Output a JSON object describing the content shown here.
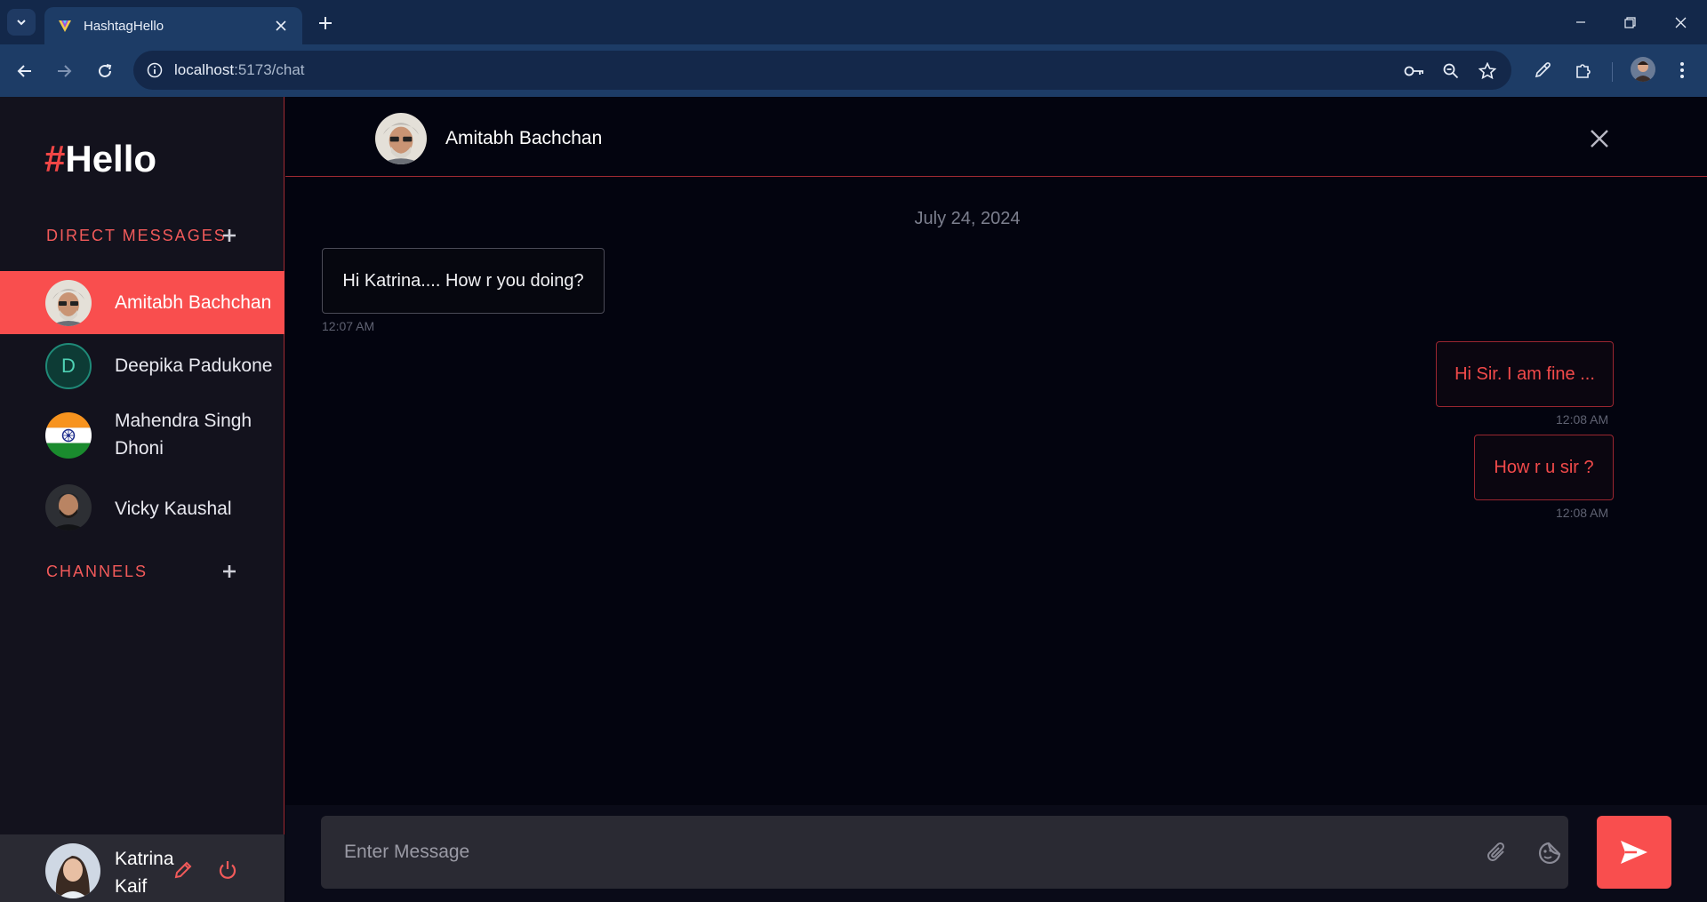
{
  "browser": {
    "tab_title": "HashtagHello",
    "url_host": "localhost",
    "url_path": ":5173/chat"
  },
  "sidebar": {
    "logo_hash": "#",
    "logo_text": "Hello",
    "direct_messages_label": "DIRECT MESSAGES",
    "channels_label": "CHANNELS",
    "contacts": [
      {
        "name": "Amitabh Bachchan",
        "active": true
      },
      {
        "name": "Deepika Padukone",
        "initial": "D"
      },
      {
        "name": "Mahendra Singh Dhoni"
      },
      {
        "name": "Vicky Kaushal"
      }
    ],
    "user": {
      "name": "Katrina Kaif"
    }
  },
  "chat": {
    "contact_name": "Amitabh Bachchan",
    "date": "July 24, 2024",
    "messages": [
      {
        "text": "Hi Katrina.... How r you doing?",
        "time": "12:07 AM",
        "direction": "in"
      },
      {
        "text": "Hi Sir. I am fine ...",
        "time": "12:08 AM",
        "direction": "out"
      },
      {
        "text": "How r u sir ?",
        "time": "12:08 AM",
        "direction": "out"
      }
    ],
    "input_placeholder": "Enter Message"
  },
  "colors": {
    "accent": "#f94e4e",
    "sidebar_bg": "#13121d",
    "chat_bg": "#03040f",
    "chrome_bg": "#1d3c66"
  }
}
